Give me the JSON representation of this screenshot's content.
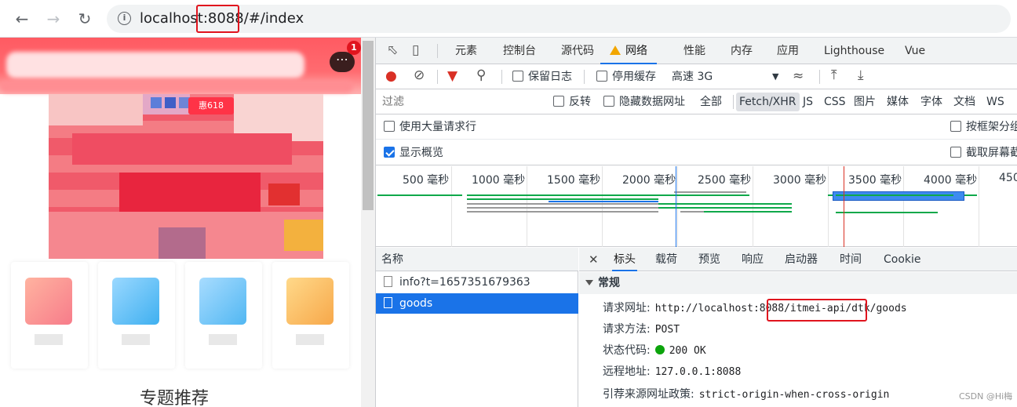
{
  "browser": {
    "url_prefix": "localhost",
    "url_port": ":8088",
    "url_suffix": "/#/index"
  },
  "page": {
    "chat_badge": "1",
    "banner_badge": "惠618",
    "section_title": "专题推荐"
  },
  "devtools": {
    "tabs": [
      "元素",
      "控制台",
      "源代码",
      "网络",
      "性能",
      "内存",
      "应用",
      "Lighthouse",
      "Vue"
    ],
    "active_tab": "网络",
    "toolbar": {
      "preserve_log": "保留日志",
      "disable_cache": "停用缓存",
      "throttle": "高速 3G"
    },
    "filter": {
      "placeholder": "过滤",
      "invert": "反转",
      "hide_data_urls": "隐藏数据网址",
      "types": [
        "全部",
        "Fetch/XHR",
        "JS",
        "CSS",
        "图片",
        "媒体",
        "字体",
        "文档",
        "WS"
      ],
      "active_type": "Fetch/XHR"
    },
    "options": {
      "large_rows": "使用大量请求行",
      "group_by_frame": "按框架分组",
      "show_overview": "显示概览",
      "capture_screenshots": "截取屏幕截图"
    },
    "timeline_ticks": [
      "500 毫秒",
      "1000 毫秒",
      "1500 毫秒",
      "2000 毫秒",
      "2500 毫秒",
      "3000 毫秒",
      "3500 毫秒",
      "4000 毫秒",
      "450"
    ],
    "requests": {
      "header": "名称",
      "rows": [
        "info?t=1657351679363",
        "goods"
      ],
      "selected": "goods"
    },
    "detail_tabs": [
      "标头",
      "载荷",
      "预览",
      "响应",
      "启动器",
      "时间",
      "Cookie"
    ],
    "active_detail_tab": "标头",
    "general": {
      "section": "常规",
      "request_url_label": "请求网址:",
      "request_url": "http://localhost:8088/itmei-api/dtk/goods",
      "method_label": "请求方法:",
      "method": "POST",
      "status_label": "状态代码:",
      "status": "200 OK",
      "remote_label": "远程地址:",
      "remote": "127.0.0.1:8088",
      "referrer_label": "引荐来源网址政策:",
      "referrer": "strict-origin-when-cross-origin"
    }
  },
  "watermark": "CSDN @Hi梅"
}
